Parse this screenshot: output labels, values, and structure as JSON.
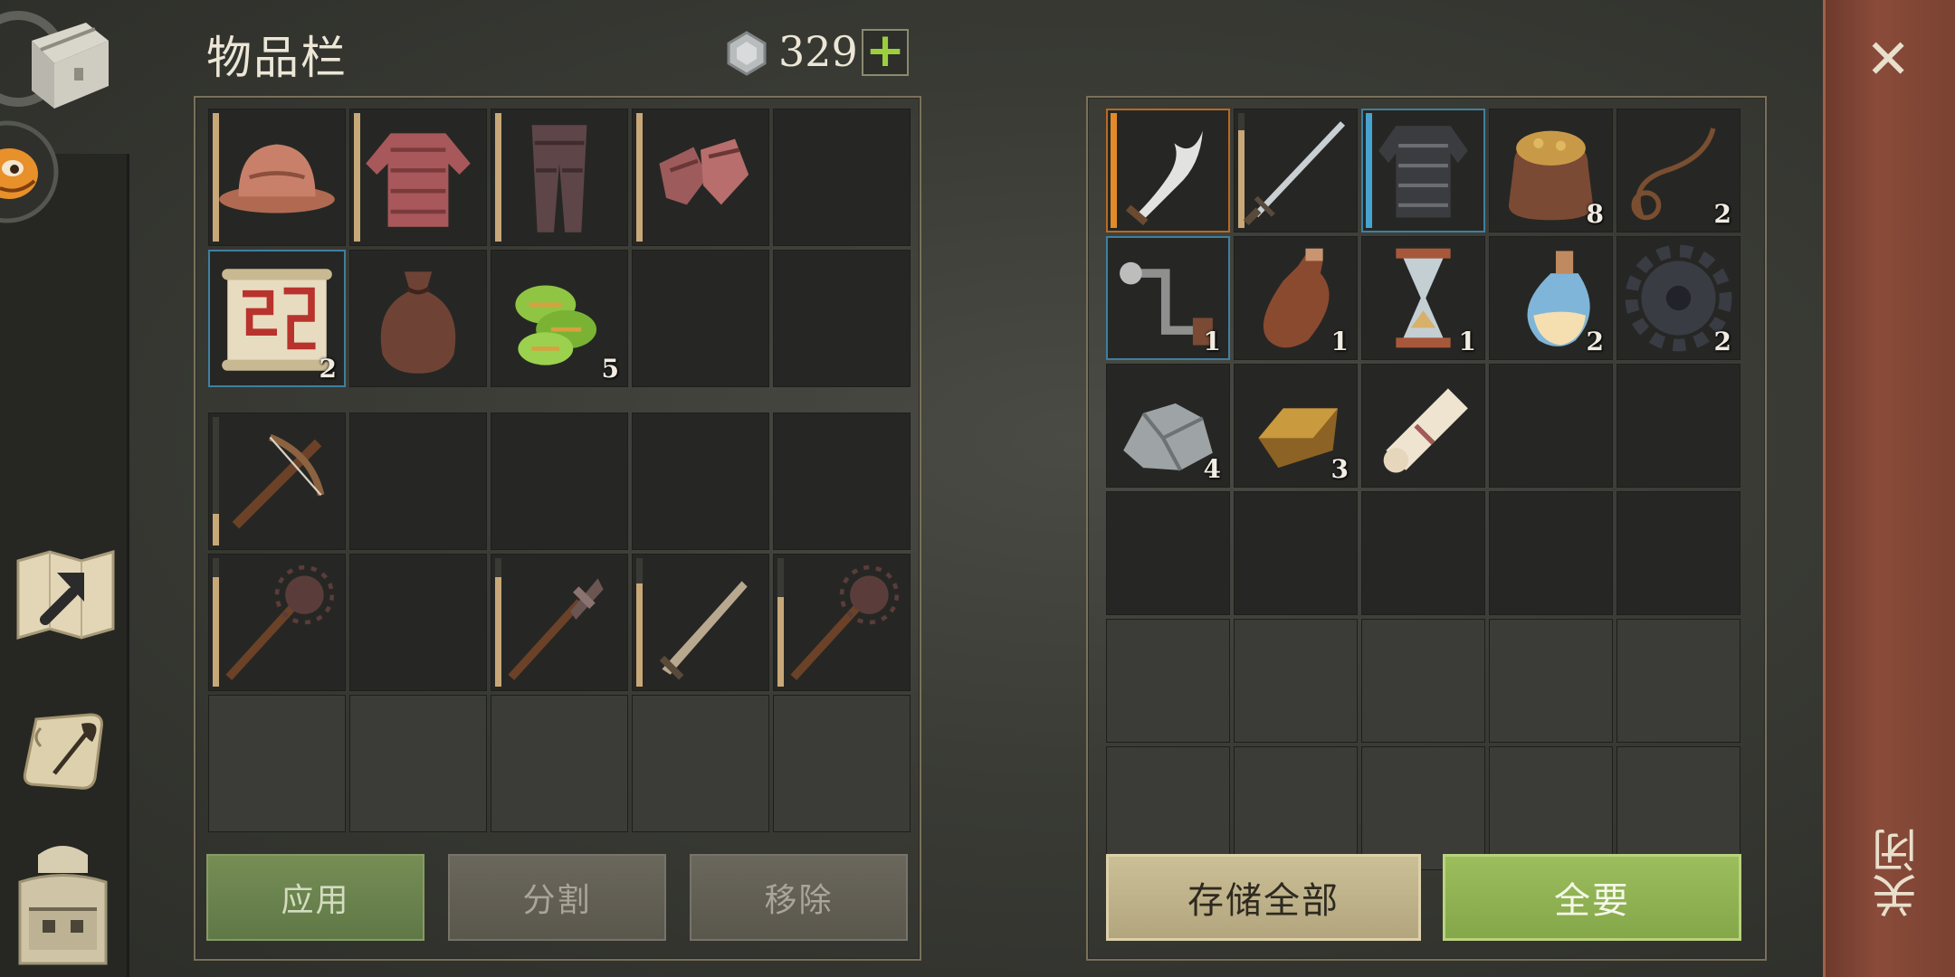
{
  "inventory": {
    "title": "物品栏",
    "currency_value": "329",
    "add_currency_label": "+"
  },
  "left_grid": {
    "rows_top": [
      [
        {
          "icon": "helmet-icon",
          "bar": 1.0
        },
        {
          "icon": "chainmail-shirt-icon",
          "bar": 1.0
        },
        {
          "icon": "chainmail-leggings-icon",
          "bar": 1.0
        },
        {
          "icon": "chainmail-gloves-icon",
          "bar": 1.0
        },
        {
          "icon": ""
        }
      ],
      [
        {
          "icon": "treasure-map-scroll-icon",
          "qty": "2",
          "highlight": "blue"
        },
        {
          "icon": "leather-bag-icon"
        },
        {
          "icon": "herb-leaves-icon",
          "qty": "5"
        },
        {
          "icon": ""
        },
        {
          "icon": ""
        }
      ]
    ],
    "rows_bottom": [
      [
        {
          "icon": "crossbow-icon",
          "bar": 0.25
        },
        {
          "icon": ""
        },
        {
          "icon": ""
        },
        {
          "icon": ""
        },
        {
          "icon": ""
        }
      ],
      [
        {
          "icon": "mace-icon",
          "bar": 0.85
        },
        {
          "icon": ""
        },
        {
          "icon": "flanged-mace-icon",
          "bar": 0.85
        },
        {
          "icon": "sword-icon",
          "bar": 0.8
        },
        {
          "icon": "mace-icon",
          "bar": 0.7
        }
      ]
    ],
    "locked_rows": 1
  },
  "right_grid": {
    "rows": [
      [
        {
          "icon": "curved-dagger-icon",
          "bar": 1.0,
          "bar_color": "orange",
          "highlight": "orange"
        },
        {
          "icon": "longsword-icon",
          "bar": 0.85
        },
        {
          "icon": "scale-armor-icon",
          "bar": 1.0,
          "bar_color": "blue",
          "highlight": "blue"
        },
        {
          "icon": "grain-sack-icon",
          "qty": "8"
        },
        {
          "icon": "rope-icon",
          "qty": "2"
        }
      ],
      [
        {
          "icon": "crank-handle-icon",
          "qty": "1",
          "highlight": "blue"
        },
        {
          "icon": "leather-flask-icon",
          "qty": "1"
        },
        {
          "icon": "hourglass-icon",
          "qty": "1"
        },
        {
          "icon": "potion-flask-icon",
          "qty": "2"
        },
        {
          "icon": "gear-icon",
          "qty": "2"
        }
      ],
      [
        {
          "icon": "stone-ore-icon",
          "qty": "4"
        },
        {
          "icon": "bronze-ingot-icon",
          "qty": "3"
        },
        {
          "icon": "paper-scroll-icon"
        },
        {
          "icon": ""
        },
        {
          "icon": ""
        }
      ],
      [
        {
          "icon": ""
        },
        {
          "icon": ""
        },
        {
          "icon": ""
        },
        {
          "icon": ""
        },
        {
          "icon": ""
        }
      ]
    ],
    "locked_rows": 2
  },
  "buttons": {
    "apply": "应用",
    "split": "分割",
    "remove": "移除",
    "store_all": "存储全部",
    "take_all": "全要"
  },
  "close": {
    "x_label": "✕",
    "label": "关闭"
  },
  "colors": {
    "accent_orange": "#e28b27",
    "accent_blue": "#47a3cf",
    "close_panel": "#8a4b3a"
  }
}
